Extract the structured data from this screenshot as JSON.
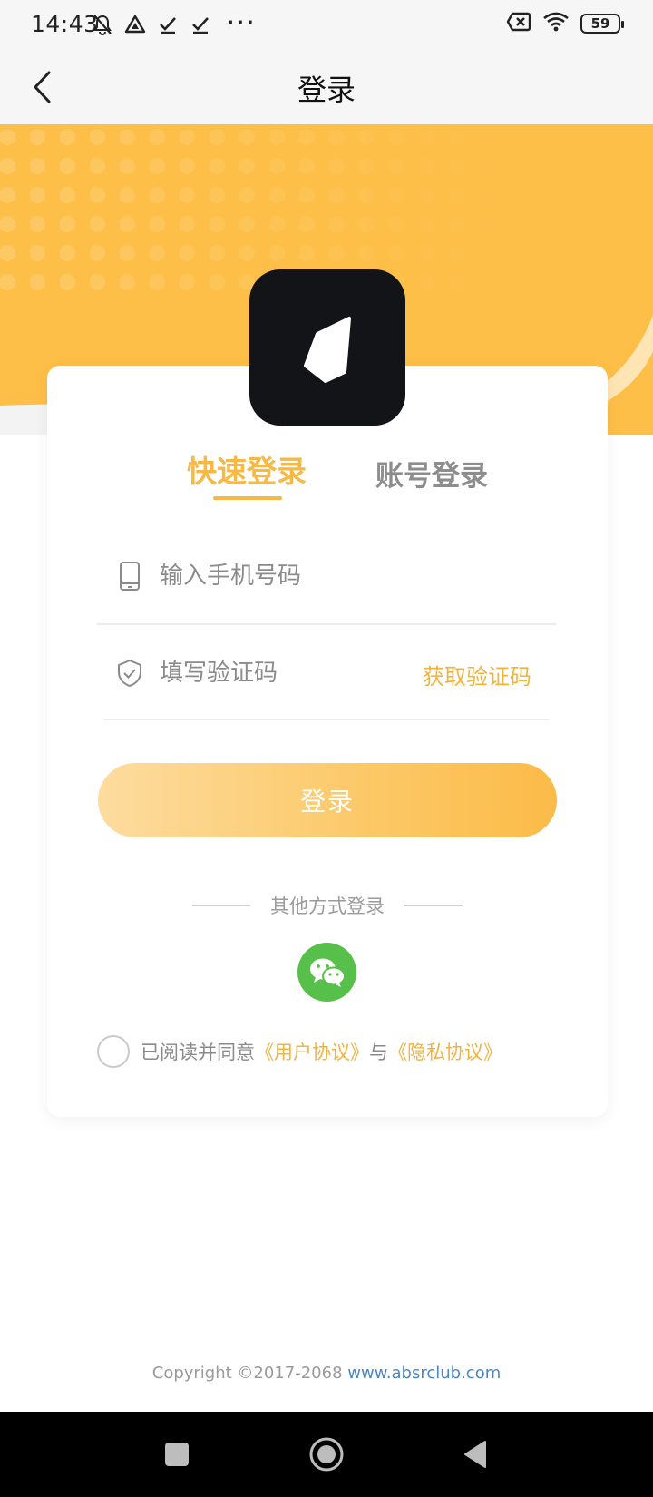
{
  "status_bar": {
    "time": "14:43",
    "dots": "···",
    "battery": "59",
    "icons": [
      "bell-off-icon",
      "drive-icon",
      "check-icon",
      "check-icon",
      "no-sim-icon",
      "wifi-icon",
      "battery-icon"
    ]
  },
  "header": {
    "title": "登录",
    "back_icon": "chevron-left-icon"
  },
  "tabs": {
    "quick_login": "快速登录",
    "account_login": "账号登录",
    "active": "quick_login"
  },
  "form": {
    "phone_placeholder": "输入手机号码",
    "code_placeholder": "填写验证码",
    "get_code": "获取验证码",
    "login_button": "登录"
  },
  "other": {
    "label": "其他方式登录",
    "wechat_icon": "wechat-icon"
  },
  "agreement": {
    "prefix": "已阅读并同意",
    "user_agreement": "《用户协议》",
    "conjunction": "与",
    "privacy_agreement": "《隐私协议》",
    "checked": false
  },
  "footer": {
    "copyright_prefix": "Copyright ©2017-2068 ",
    "site": "www.absrclub.com"
  },
  "colors": {
    "accent": "#f7b844",
    "hero": "#fdbf48",
    "wechat": "#56c04a",
    "logo_bg": "#131418"
  }
}
